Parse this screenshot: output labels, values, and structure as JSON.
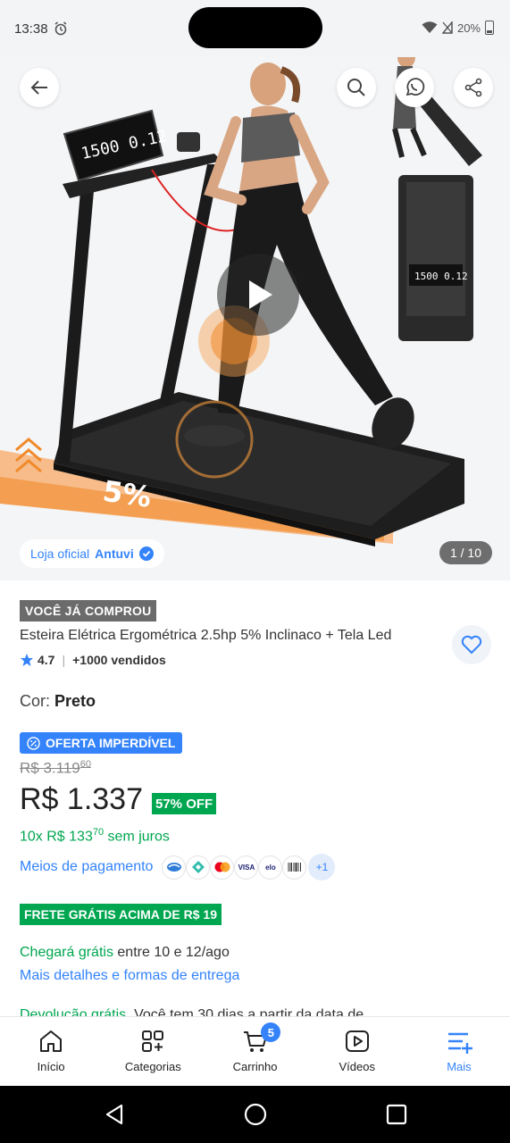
{
  "status_bar": {
    "time": "13:38",
    "battery": "20%"
  },
  "gallery": {
    "store_label": "Loja oficial",
    "store_name": "Antuvi",
    "page_counter": "1 / 10",
    "display_text": "1500 0.12",
    "incline_label": "5%"
  },
  "product": {
    "bought_tag": "VOCÊ JÁ COMPROU",
    "title": "Esteira Elétrica Ergométrica 2.5hp 5% Inclinaco + Tela Led",
    "rating": "4.7",
    "sold": "+1000 vendidos",
    "color_label": "Cor:",
    "color_value": "Preto",
    "deal_badge": "OFERTA IMPERDÍVEL",
    "old_price_main": "R$ 3.119",
    "old_price_cents": "60",
    "price": "R$ 1.337",
    "discount": "57% OFF",
    "installments_main": "10x R$ 133",
    "installments_cents": "70",
    "installments_suffix": "sem juros",
    "payments_link": "Meios de pagamento",
    "payment_more": "+1",
    "payment_icons": [
      "card-icon",
      "pix-icon",
      "mastercard-icon",
      "visa-icon",
      "elo-icon",
      "boleto-icon"
    ],
    "visa_text": "VISA",
    "elo_text": "elo",
    "shipping_badge": "FRETE GRÁTIS ACIMA DE R$ 19",
    "arrival_free": "Chegará grátis",
    "arrival_rest": "entre 10 e 12/ago",
    "delivery_link": "Mais detalhes e formas de entrega",
    "returns_free": "Devolução grátis.",
    "returns_rest": "Você tem 30 dias a partir da data de"
  },
  "bottom_nav": {
    "items": [
      {
        "label": "Início",
        "icon": "home-icon"
      },
      {
        "label": "Categorias",
        "icon": "categories-icon"
      },
      {
        "label": "Carrinho",
        "icon": "cart-icon",
        "badge": "5"
      },
      {
        "label": "Vídeos",
        "icon": "video-icon"
      },
      {
        "label": "Mais",
        "icon": "more-icon",
        "active": true
      }
    ]
  },
  "colors": {
    "accent": "#3483fa",
    "green": "#00a650",
    "tag_gray": "#6b6b6b"
  }
}
